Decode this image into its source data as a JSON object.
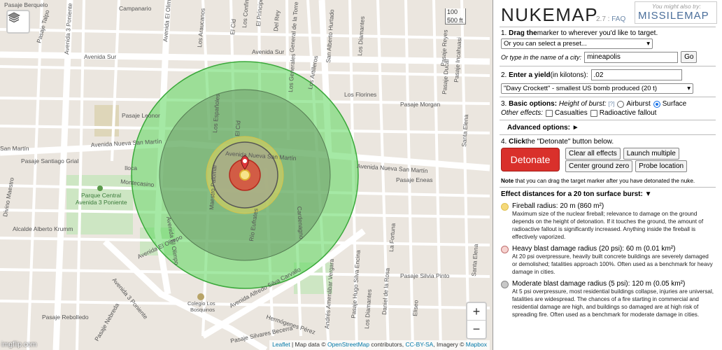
{
  "map": {
    "streets": {
      "pasaje_berquelo": "Pasaje Berquelo",
      "campanario": "Campanario",
      "av_el_olimpo_top": "Avenida El Olimpo",
      "los_araucanos": "Los Araucanos",
      "el_cid": "El Cid",
      "los_confines": "Los Confines",
      "el_principe": "El Príncipe",
      "del_rey": "Del Rey",
      "general_de_la_torre": "General de la Torre",
      "san_alberto_hurtado": "San Alberto Hurtado",
      "los_diamantes_top": "Los Diamantes",
      "pasaje_talpo": "Pasaje Talpo",
      "av_3_poniente_top": "Avenida 3 Poniente",
      "av_sur_left": "Avenida Sur",
      "av_sur_center": "Avenida Sur",
      "los_generales": "Los Generales",
      "los_artilleros": "Los Artilleros",
      "los_florines": "Los Florines",
      "pasaje_morgan": "Pasaje Morgan",
      "pasaje_incahuasi": "Pasaje Incahuasi",
      "pasaje_ducal": "Pasaje Ducal",
      "pasaje_reyes": "Pasaje Reyes",
      "pasaje_leonor": "Pasaje Leonor",
      "los_espanoles": "Los Españoles",
      "el_cid_center": "El Cid",
      "santa_elena": "Santa Elena",
      "san_martin_left": "San Martín",
      "av_nueva_san_martin_left": "Avenida Nueva San Martín",
      "av_nueva_san_martin_center": "Avenida Nueva San Martín",
      "av_nueva_san_martin_right": "Avenida Nueva San Martín",
      "pasaje_santiago_grial": "Pasaje Santiago Grial",
      "iloca": "Iloca",
      "montecasino": "Montecasino",
      "maestro_palomar": "Maestro Palomar",
      "cardenagno": "Cardenagno",
      "pasaje_eneas": "Pasaje Eneas",
      "divino_maestro": "Divino Maestro",
      "av_el_olimpo_mid": "Avenida El Olimpo",
      "parque_central": "Parque Central",
      "parque_central_2": "Avenida 3 Poniente",
      "alcalde_alberto_krumm": "Alcalde Alberto Krumm",
      "rio_eufrates": "Río Eufrates",
      "la_fortuna": "La Fortuna",
      "santa_elena_2": "Santa Elena",
      "pasaje_silvia_pinto": "Pasaje Silvia Pinto",
      "av_el_olimpo_bottom": "Avenida El Olimpo",
      "av_alfredo_silva_carvallo": "Avenida Alfredo Silva Carvallo",
      "andres_amenabar_vergara": "Andrés Amenábar Vergara",
      "pasaje_hugo_silva_encina": "Pasaje Hugo Silva Encina",
      "daniel_de_la_rosa": "Daniel de la Rosa",
      "los_diamantes_bottom": "Los Diamantes",
      "elisea": "Eliseo",
      "av_3_poniente_bottom": "Avenida 3 Poniente",
      "colegio": "Colegio Los",
      "colegio_2": "Bosquinos",
      "pasaje_rebolledo": "Pasaje Rebolledo",
      "hermogenes_perez": "Hermógenes Pérez",
      "pasaje_silvares_becerra": "Pasaje Silvares Becerra",
      "pasaje_nebreda": "Pasaje Nebreda"
    },
    "scale_m": "100 m",
    "scale_ft": "500 ft",
    "zoom_in": "+",
    "zoom_out": "−",
    "attribution": {
      "leaflet": "Leaflet",
      "map_data": " | Map data © ",
      "osm": "OpenStreetMap",
      "contrib": " contributors, ",
      "ccbysa": "CC-BY-SA",
      "imagery": ", Imagery © ",
      "mapbox": "Mapbox"
    },
    "watermark": "imgflip.com"
  },
  "panel": {
    "logo": "NUKEMAP",
    "version": "2.7",
    "faq": "FAQ",
    "also_try": "You might also try:",
    "missilemap": "MISSILEMAP",
    "step1_num": "1.",
    "step1_bold": "Drag the",
    "step1_rest": " marker to wherever you'd like to target.",
    "preset_placeholder": "Or you can select a preset...",
    "city_label": "Or type in the name of a city:",
    "city_value": "mineapolis",
    "go_button": "Go",
    "step2_num": "2.",
    "step2_bold": "Enter a yield",
    "step2_rest": " (in kilotons):",
    "yield_value": ".02",
    "yield_preset": "\"Davy Crockett\" - smallest US bomb produced (20 t)",
    "step3_num": "3.",
    "step3_bold": "Basic options:",
    "height_label": "Height of burst:",
    "help": "[?]",
    "airburst": "Airburst",
    "surface": "Surface",
    "other_effects": "Other effects:",
    "casualties": "Casualties",
    "fallout": "Radioactive fallout",
    "advanced": "Advanced options: ►",
    "step4_num": "4.",
    "step4_bold": "Click",
    "step4_rest": " the \"Detonate\" button below.",
    "detonate": "Detonate",
    "clear_effects": "Clear all effects",
    "launch_multiple": "Launch multiple",
    "center_ground_zero": "Center ground zero",
    "probe_location": "Probe location",
    "note_bold": "Note",
    "note_rest": " that you can drag the target marker after you have detonated the nuke.",
    "effects_header": "Effect distances for a 20 ton surface burst: ▼",
    "effects": [
      {
        "title": "Fireball radius: 20 m (860 m²)",
        "desc": "Maximum size of the nuclear fireball; relevance to damage on the ground depends on the height of detonation. If it touches the ground, the amount of radioactive fallout is significantly increased. Anything inside the fireball is effectively vaporized.",
        "color": "#f5d97a"
      },
      {
        "title": "Heavy blast damage radius (20 psi): 60 m (0.01 km²)",
        "desc": "At 20 psi overpressure, heavily built concrete buildings are severely damaged or demolished; fatalities approach 100%. Often used as a benchmark for heavy damage in cities.",
        "color": "#f6d3d0"
      },
      {
        "title": "Moderate blast damage radius (5 psi): 120 m (0.05 km²)",
        "desc": "At 5 psi overpressure, most residential buildings collapse, injuries are universal, fatalities are widespread. The chances of a fire starting in commercial and residential damage are high, and buildings so damaged are at high risk of spreading fire. Often used as a benchmark for moderate damage in cities.",
        "color": "#c8c8c8"
      }
    ]
  },
  "colors": {
    "detonate": "#d9302b",
    "thermal": "#5bd75b",
    "blast_light": "#6e9a6a",
    "fireball": "#f0e07a",
    "heavy": "#d93a2a"
  }
}
